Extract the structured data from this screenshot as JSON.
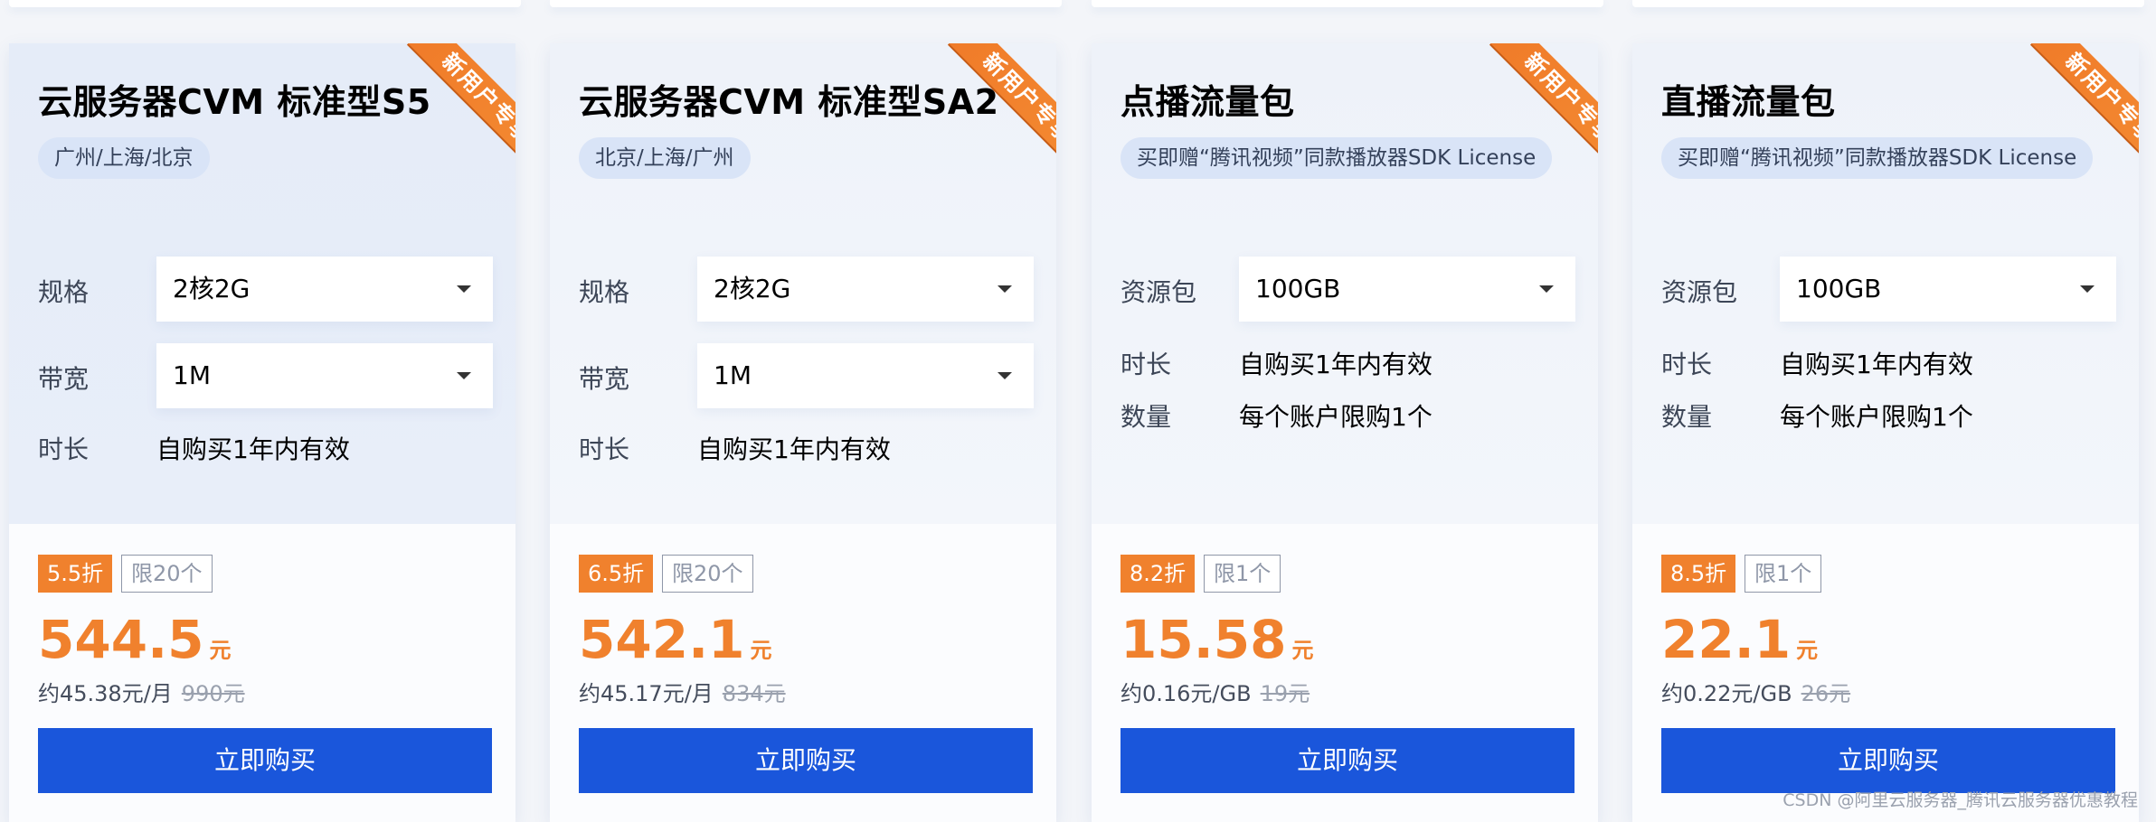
{
  "ribbon_label": "新用户专享",
  "buy_label": "立即购买",
  "watermark": "CSDN @阿里云服务器_腾讯云服务器优惠教程",
  "colors": {
    "accent": "#f0812d",
    "button": "#1a56db"
  },
  "cards": [
    {
      "title": "云服务器CVM 标准型S5",
      "chip": "广州/上海/北京",
      "spec_label": "规格",
      "spec_value": "2核2G",
      "bandwidth_label": "带宽",
      "bandwidth_value": "1M",
      "duration_label": "时长",
      "duration_value": "自购买1年内有效",
      "discount": "5.5折",
      "limit": "限20个",
      "price": "544.5",
      "unit": "元",
      "per_unit": "约45.38元/月",
      "original": "990元"
    },
    {
      "title": "云服务器CVM 标准型SA2",
      "chip": "北京/上海/广州",
      "spec_label": "规格",
      "spec_value": "2核2G",
      "bandwidth_label": "带宽",
      "bandwidth_value": "1M",
      "duration_label": "时长",
      "duration_value": "自购买1年内有效",
      "discount": "6.5折",
      "limit": "限20个",
      "price": "542.1",
      "unit": "元",
      "per_unit": "约45.17元/月",
      "original": "834元"
    },
    {
      "title": "点播流量包",
      "chip": "买即赠“腾讯视频”同款播放器SDK License",
      "package_label": "资源包",
      "package_value": "100GB",
      "duration_label": "时长",
      "duration_value": "自购买1年内有效",
      "quantity_label": "数量",
      "quantity_value": "每个账户限购1个",
      "discount": "8.2折",
      "limit": "限1个",
      "price": "15.58",
      "unit": "元",
      "per_unit": "约0.16元/GB",
      "original": "19元"
    },
    {
      "title": "直播流量包",
      "chip": "买即赠“腾讯视频”同款播放器SDK License",
      "package_label": "资源包",
      "package_value": "100GB",
      "duration_label": "时长",
      "duration_value": "自购买1年内有效",
      "quantity_label": "数量",
      "quantity_value": "每个账户限购1个",
      "discount": "8.5折",
      "limit": "限1个",
      "price": "22.1",
      "unit": "元",
      "per_unit": "约0.22元/GB",
      "original": "26元"
    }
  ]
}
